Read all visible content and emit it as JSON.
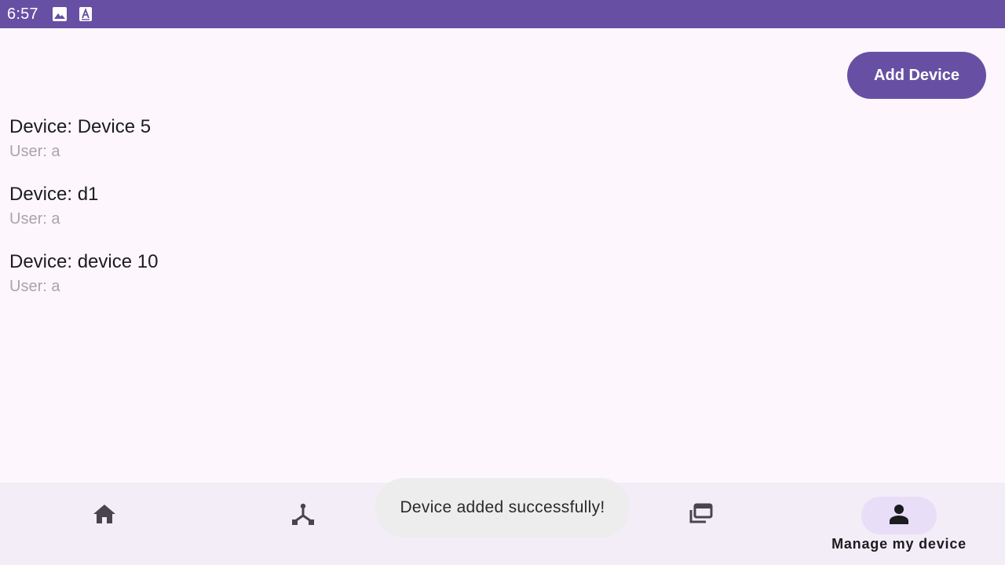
{
  "status_bar": {
    "time": "6:57",
    "icons": [
      "image-icon",
      "text-a-icon"
    ]
  },
  "header": {
    "add_device_label": "Add Device"
  },
  "devices": [
    {
      "device_label": "Device: Device 5",
      "user_label": "User: a"
    },
    {
      "device_label": "Device: d1",
      "user_label": "User: a"
    },
    {
      "device_label": "Device: device 10",
      "user_label": "User: a"
    }
  ],
  "bottom_nav": {
    "items": [
      {
        "icon": "home-icon",
        "label": "",
        "active": false
      },
      {
        "icon": "hub-icon",
        "label": "",
        "active": false
      },
      {
        "icon": "expand-less-icon",
        "label": "",
        "active": false
      },
      {
        "icon": "gallery-icon",
        "label": "",
        "active": false
      },
      {
        "icon": "person-icon",
        "label": "Manage my device",
        "active": true
      }
    ]
  },
  "toast": {
    "message": "Device added successfully!"
  },
  "colors": {
    "primary": "#6750A4",
    "background": "#FDF7FD",
    "nav_background": "#F3EDF7",
    "nav_active_indicator": "#E8DEF8",
    "secondary_text": "#A8A5AA"
  }
}
